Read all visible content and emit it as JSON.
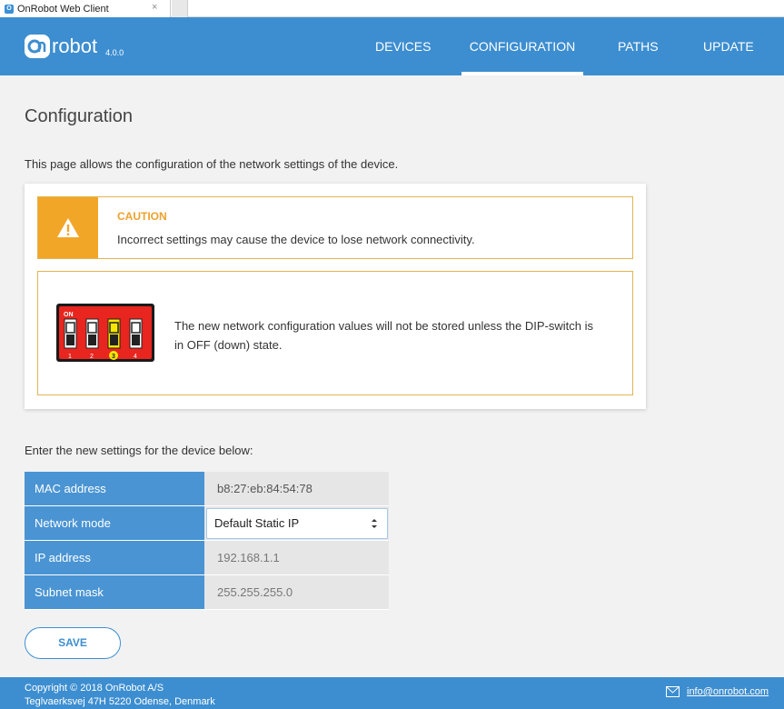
{
  "browser": {
    "tab_title": "OnRobot Web Client",
    "tab_close": "×"
  },
  "header": {
    "logo_text": "robot",
    "logo_mark": "On",
    "version": "4.0.0",
    "nav": {
      "devices": "DEVICES",
      "configuration": "CONFIGURATION",
      "paths": "PATHS",
      "update": "UPDATE"
    },
    "active_nav": "CONFIGURATION"
  },
  "page": {
    "title": "Configuration",
    "intro": "This page allows the configuration of the network settings of the device."
  },
  "caution": {
    "title": "CAUTION",
    "text": "Incorrect settings may cause the device to lose network connectivity.",
    "icon": "warning-icon"
  },
  "dip": {
    "text": "The new network configuration values will not be stored unless the DIP-switch is in OFF (down) state.",
    "on_label": "ON",
    "switch_numbers": [
      "1",
      "2",
      "3",
      "4"
    ],
    "highlighted_switch": "3"
  },
  "settings": {
    "prompt": "Enter the new settings for the device below:",
    "mac_label": "MAC address",
    "mac_value": "b8:27:eb:84:54:78",
    "mode_label": "Network mode",
    "mode_value": "Default Static IP",
    "ip_label": "IP address",
    "ip_value": "192.168.1.1",
    "subnet_label": "Subnet mask",
    "subnet_value": "255.255.255.0"
  },
  "save_label": "SAVE",
  "footer": {
    "copyright": "Copyright © 2018 OnRobot A/S",
    "address": "Teglvaerksvej 47H 5220 Odense, Denmark",
    "email": "info@onrobot.com"
  },
  "colors": {
    "primary": "#3d8ed0",
    "caution": "#f2a628",
    "border": "#e0b552"
  }
}
